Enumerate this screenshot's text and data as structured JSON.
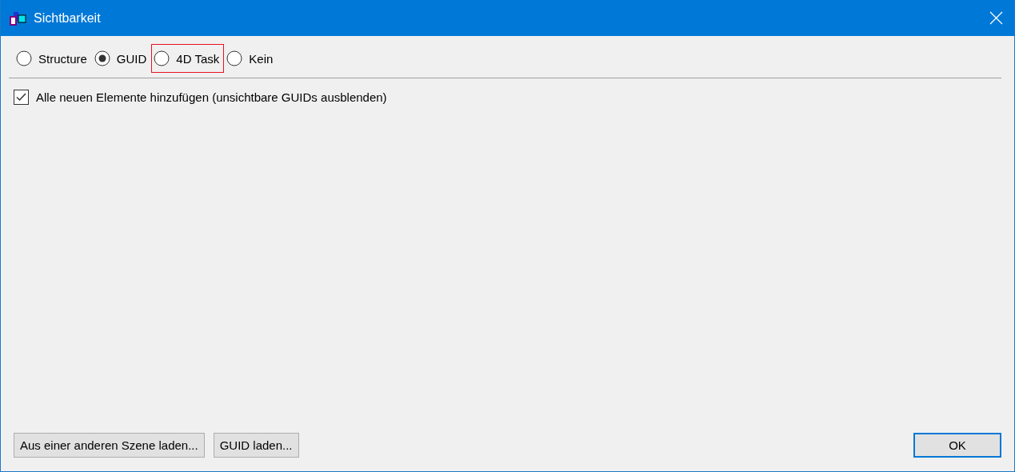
{
  "window": {
    "title": "Sichtbarkeit"
  },
  "radios": [
    {
      "label": "Structure",
      "selected": false,
      "highlighted": false
    },
    {
      "label": "GUID",
      "selected": true,
      "highlighted": false
    },
    {
      "label": "4D Task",
      "selected": false,
      "highlighted": true
    },
    {
      "label": "Kein",
      "selected": false,
      "highlighted": false
    }
  ],
  "checkbox": {
    "label": "Alle neuen Elemente hinzufügen (unsichtbare GUIDs ausblenden)",
    "checked": true
  },
  "buttons": [
    {
      "label": "Aus einer anderen Szene laden...",
      "default": false
    },
    {
      "label": "GUID laden...",
      "default": false
    }
  ],
  "ok_button": {
    "label": "OK",
    "default": true
  }
}
